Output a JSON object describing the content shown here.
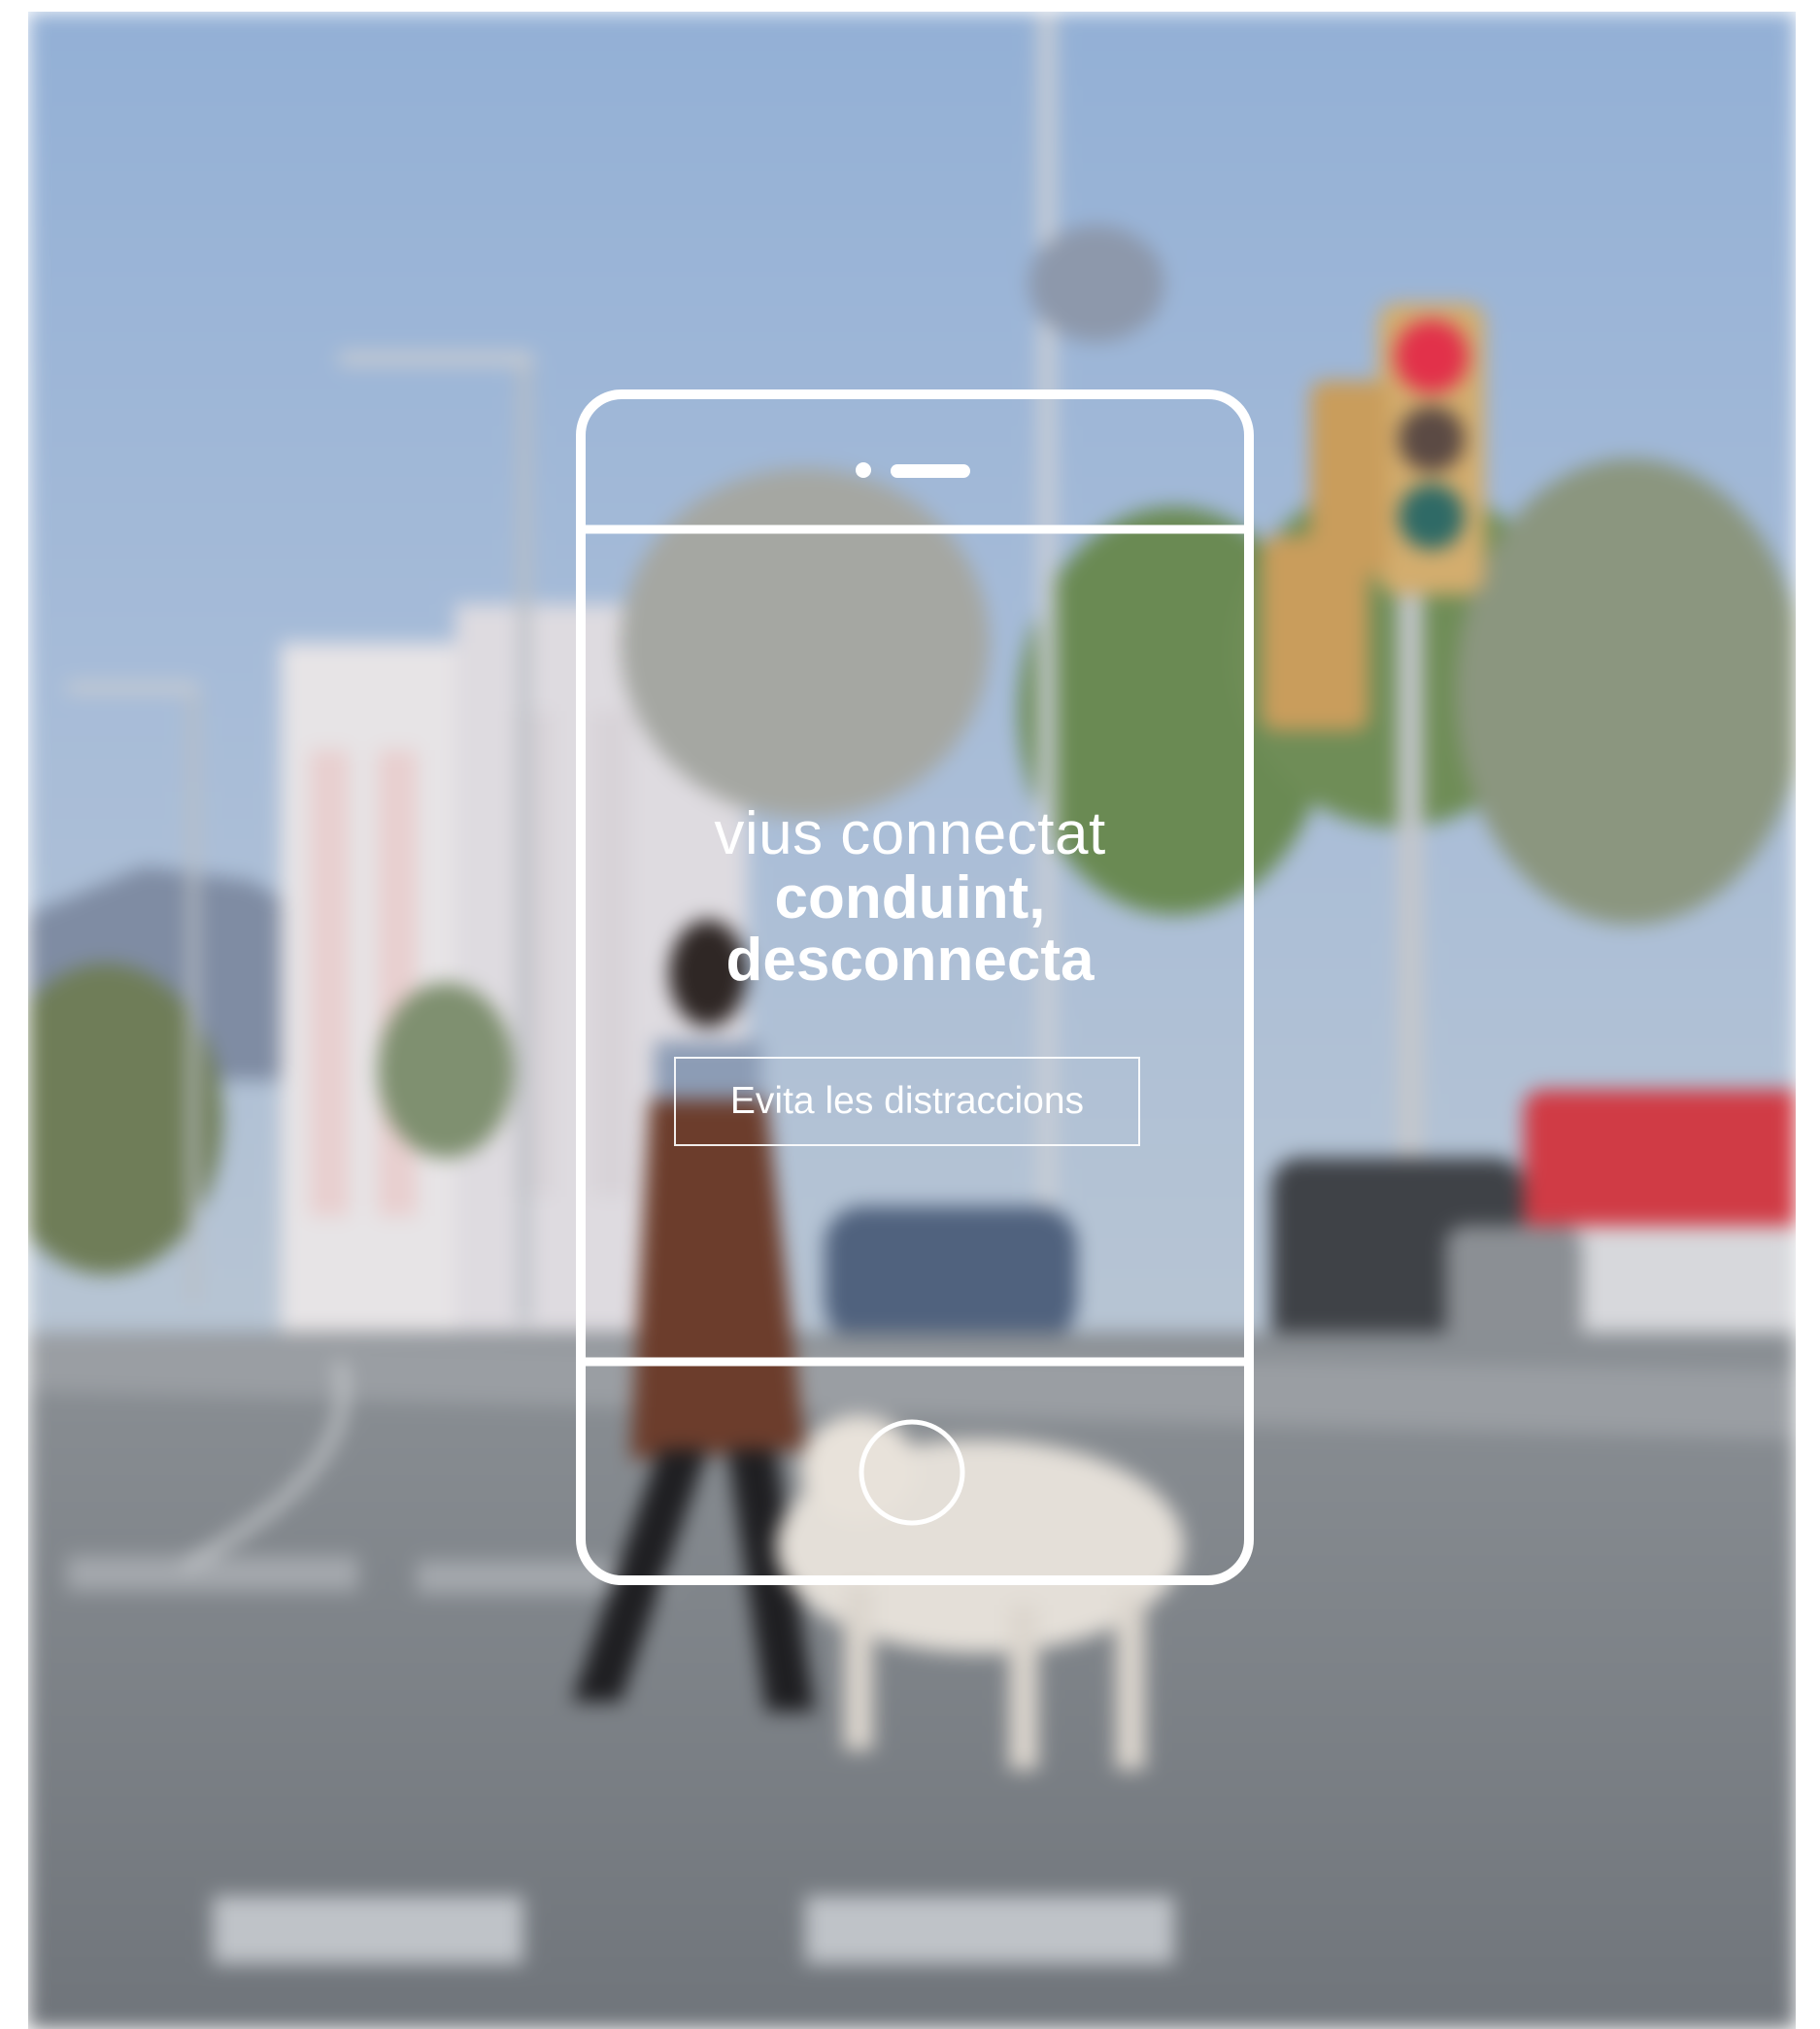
{
  "headline": {
    "line1": "vius connectat",
    "line2": "conduint,",
    "line3": "desconnecta"
  },
  "cta": {
    "label": "Evita les distraccions"
  },
  "colors": {
    "sky": "#9db6d8",
    "road": "#7d8287",
    "text": "#ffffff",
    "traffic_light_red": "#e2314a"
  },
  "icons": [
    "smartphone-outline-icon",
    "home-button-icon",
    "speaker-icon"
  ]
}
